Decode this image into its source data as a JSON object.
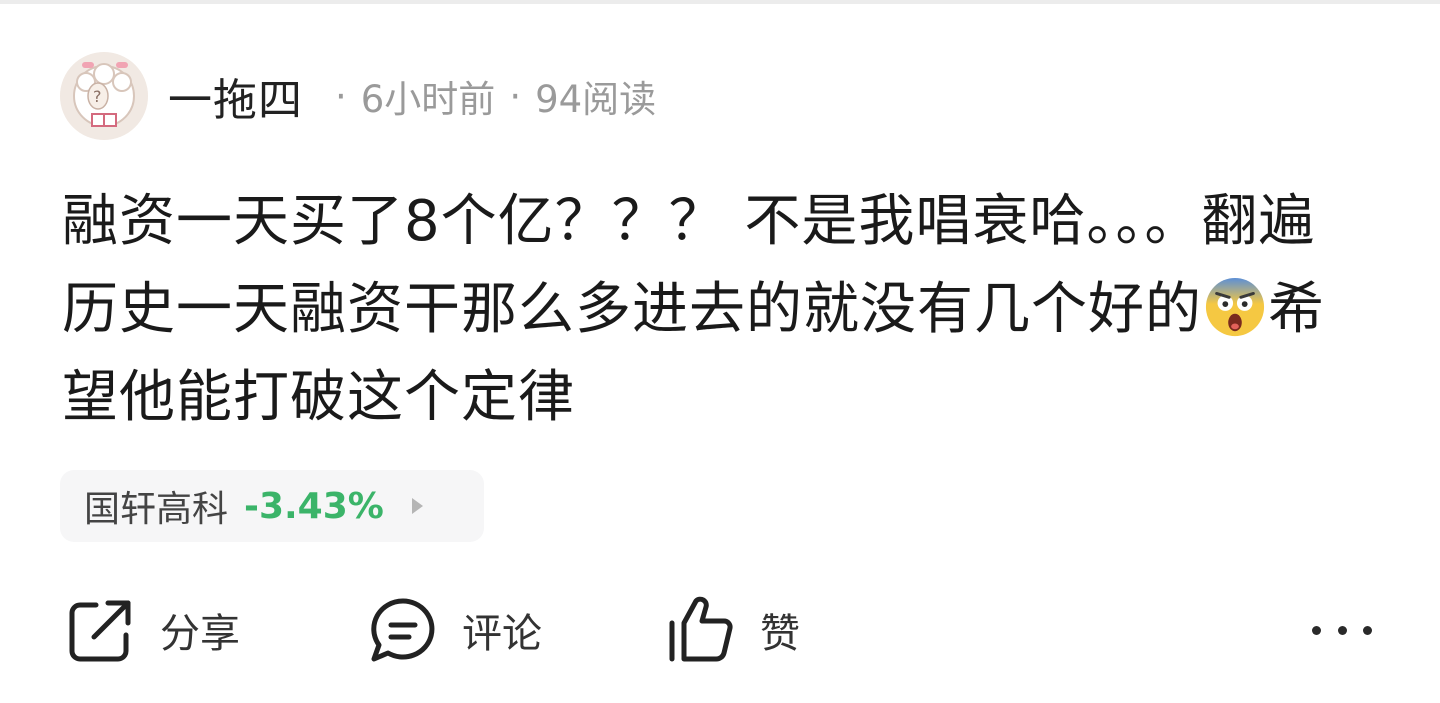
{
  "author": {
    "name": "一拖四",
    "avatar_icon": "sheep-avatar-icon"
  },
  "meta": {
    "separator": "·",
    "time": "6小时前",
    "reads": "94阅读"
  },
  "post": {
    "text_before_emoji": "融资一天买了8个亿？？？ 不是我唱衰哈。。。翻遍历史一天融资干那么多进去的就没有几个好的",
    "emoji": "screaming-face-emoji",
    "text_after_emoji": "希望他能打破这个定律"
  },
  "stock": {
    "name": "国轩高科",
    "change": "-3.43%",
    "change_color": "#3bb469"
  },
  "actions": {
    "share_label": "分享",
    "comment_label": "评论",
    "like_label": "赞"
  }
}
